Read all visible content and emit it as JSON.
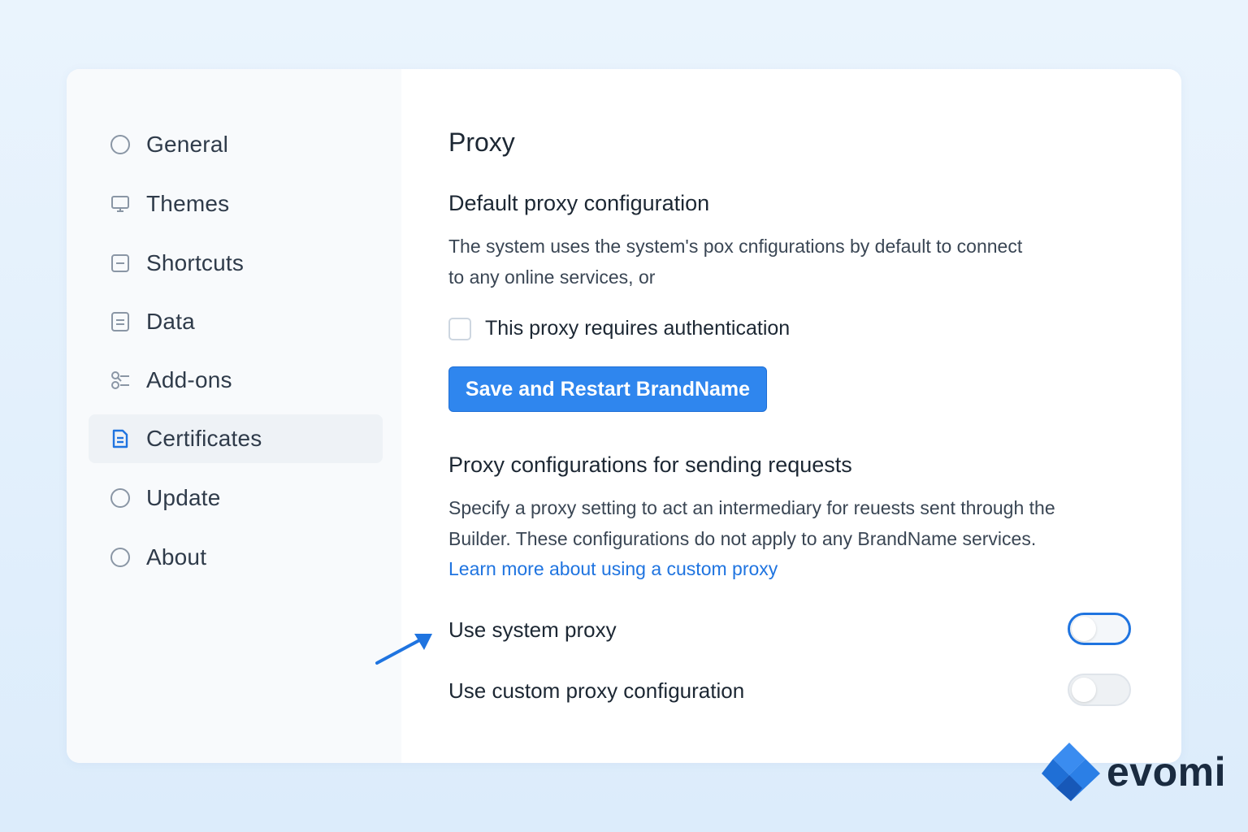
{
  "sidebar": {
    "items": [
      {
        "label": "General",
        "icon": "circle-icon"
      },
      {
        "label": "Themes",
        "icon": "monitor-icon"
      },
      {
        "label": "Shortcuts",
        "icon": "shortcut-icon"
      },
      {
        "label": "Data",
        "icon": "data-icon"
      },
      {
        "label": "Add-ons",
        "icon": "addons-icon"
      },
      {
        "label": "Certificates",
        "icon": "certificate-icon",
        "active": true
      },
      {
        "label": "Update",
        "icon": "circle-icon"
      },
      {
        "label": "About",
        "icon": "circle-icon"
      }
    ]
  },
  "main": {
    "title": "Proxy",
    "default_section": {
      "heading": "Default proxy configuration",
      "description_line1": "The system uses the system's pox  cnfigurations by default to connect",
      "description_line2": "to any online services, or",
      "checkbox_label": "This proxy requires authentication",
      "checkbox_checked": false,
      "button_label": "Save and Restart BrandName"
    },
    "requests_section": {
      "heading": "Proxy configurations for sending requests",
      "description_line1": "Specify a proxy setting to act an intermediary for reuests sent through the",
      "description_line2": "Builder. These configurations do not apply to any BrandName services.",
      "link_text": "Learn more about using a custom proxy",
      "toggles": [
        {
          "label": "Use system proxy",
          "state": "focused"
        },
        {
          "label": "Use custom proxy configuration",
          "state": "off"
        }
      ]
    }
  },
  "brand": {
    "name": "evomi"
  },
  "colors": {
    "accent": "#1f74e0",
    "button": "#2f86ee",
    "background": "#e3effb"
  }
}
